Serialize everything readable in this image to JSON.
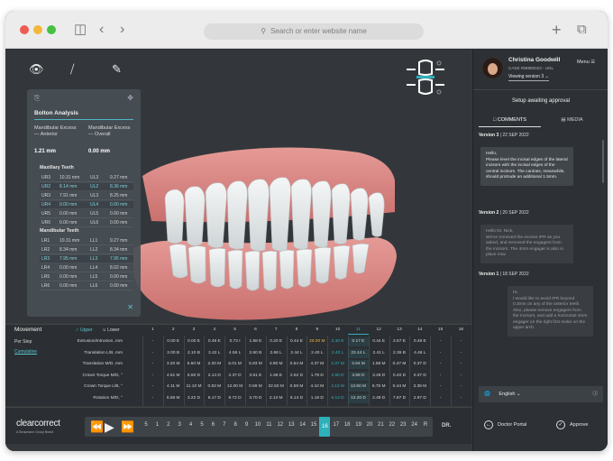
{
  "browser": {
    "url_placeholder": "Search or enter website name"
  },
  "user": {
    "name": "Christina Goodwill",
    "case": "CASE #59850023 - UNL",
    "version_select": "Viewing version 3",
    "menu_label": "Menu"
  },
  "panel": {
    "status": "Setup awaiting approval",
    "tabs": [
      "COMMENTS",
      "MEDIA"
    ],
    "comments": [
      {
        "version": "Version 3",
        "date": "22 SEP 2022",
        "text": "Hello,\nPlease level the incisal edges of the lateral incisors with the incisal edges of the central incisors. The canines, meanwhile, should protrude an additional 1.5mm.",
        "muted": false,
        "align": "left"
      },
      {
        "version": "Version 2",
        "date": "20 SEP 2022",
        "text": "Hello Dr. Nick,\nWe've removed the excess IPR as you asked, and removed the engagers from the incisors. The 4mm engager is also in place now.",
        "muted": true,
        "align": "left"
      },
      {
        "version": "Version 1",
        "date": "18 SEP 2022",
        "text": "Hi,\nI would like to avoid IPR beyond 0.3mm on any of the anterior teeth. Also, please remove engagers from the incisors, and add a horizontal 4mm engager on the right first molar on the upper arch.",
        "muted": true,
        "align": "right"
      }
    ],
    "language": "English",
    "doctor_portal": "Doctor Portal",
    "approve": "Approve"
  },
  "bolton": {
    "title": "Bolton Analysis",
    "anterior_label": "Mandibular Excess— Anterior",
    "overall_label": "Mandibular Excess— Overall",
    "anterior_value": "1.21 mm",
    "overall_value": "0.00 mm",
    "maxillary_title": "Maxillary Teeth",
    "mandibular_title": "Mandibular Teeth",
    "maxillary_rows": [
      {
        "a": "UR3",
        "b": "10.31 mm",
        "c": "UL3",
        "d": "9.27 mm",
        "hl": false
      },
      {
        "a": "UR2",
        "b": "8.14 mm",
        "c": "UL2",
        "d": "8.36 mm",
        "hl": true
      },
      {
        "a": "UR3",
        "b": "7.91 mm",
        "c": "UL3",
        "d": "8.25 mm",
        "hl": false
      },
      {
        "a": "UR4",
        "b": "0.00 mm",
        "c": "UL4",
        "d": "0.00 mm",
        "hl": true
      },
      {
        "a": "UR5",
        "b": "0.00 mm",
        "c": "UL5",
        "d": "0.00 mm",
        "hl": false
      },
      {
        "a": "UR6",
        "b": "0.00 mm",
        "c": "UL6",
        "d": "0.00 mm",
        "hl": false
      }
    ],
    "mandibular_rows": [
      {
        "a": "LR1",
        "b": "10.31 mm",
        "c": "LL1",
        "d": "9.27 mm",
        "hl": false
      },
      {
        "a": "LR2",
        "b": "8.34 mm",
        "c": "LL2",
        "d": "8.34 mm",
        "hl": false
      },
      {
        "a": "LR3",
        "b": "7.95 mm",
        "c": "LL3",
        "d": "7.95 mm",
        "hl": true
      },
      {
        "a": "LR4",
        "b": "0.00 mm",
        "c": "LL4",
        "d": "8.02 mm",
        "hl": false
      },
      {
        "a": "LR5",
        "b": "0.00 mm",
        "c": "LL5",
        "d": "0.00 mm",
        "hl": false
      },
      {
        "a": "LR6",
        "b": "0.00 mm",
        "c": "LL6",
        "d": "0.00 mm",
        "hl": false
      }
    ]
  },
  "movement": {
    "title": "Movement",
    "upper": "Upper",
    "lower": "Lower",
    "per_step": "Per Step",
    "cumulative": "Cumulative",
    "columns": [
      "1",
      "2",
      "3",
      "4",
      "5",
      "6",
      "7",
      "8",
      "9",
      "10",
      "11",
      "12",
      "13",
      "14",
      "15",
      "16"
    ],
    "highlight_col": 10,
    "rows": [
      {
        "label": "Extrusion/Intrusion, mm",
        "cells": [
          "-",
          "0.00 E",
          "0.00 E",
          "0.49 E",
          "0.73 I",
          "1.58 E",
          "0.20 E",
          "0.44 E",
          "20.00 M",
          "2.40 E",
          "0.17 E",
          "0.44 E",
          "2.67 E",
          "0.49 E",
          "-",
          "-"
        ]
      },
      {
        "label": "Translation L/B, mm",
        "cells": [
          "-",
          "2.00 B",
          "2.10 B",
          "2.42 L",
          "4.56 L",
          "2.60 B",
          "2.66 L",
          "2.44 L",
          "2.40 L",
          "2.40 L",
          "22.44 L",
          "2.41 L",
          "2.36 B",
          "4.46 L",
          "-",
          "-"
        ]
      },
      {
        "label": "Translation M/D, mm",
        "cells": [
          "-",
          "3.20 M",
          "6.50 M",
          "2.20 M",
          "6.01 M",
          "5.83 M",
          "3.90 M",
          "0.54 M",
          "4.37 M",
          "4.37 M",
          "3.94 M",
          "1.58 M",
          "0.47 M",
          "0.37 D",
          "-",
          "-"
        ]
      },
      {
        "label": "Crown Torque M/D, °",
        "cells": [
          "-",
          "4.51 M",
          "6.50 D",
          "2.14 D",
          "2.37 D",
          "3.51 E",
          "1.56 E",
          "2.52 D",
          "1.79 D",
          "2.50 D",
          "3.58 D",
          "3.26 D",
          "0.40 D",
          "0.37 D",
          "-",
          "-"
        ]
      },
      {
        "label": "Crown Torque L/B, °",
        "cells": [
          "-",
          "4.11 M",
          "11.10 M",
          "0.83 M",
          "12.00 M",
          "0.59 M",
          "22.50 M",
          "0.59 M",
          "4.10 M",
          "4.10 M",
          "13.50 M",
          "6.75 M",
          "0.44 M",
          "3.39 M",
          "-",
          "-"
        ]
      },
      {
        "label": "Rotation M/D, °",
        "cells": [
          "-",
          "6.59 M",
          "3.22 D",
          "6.17 D",
          "9.72 D",
          "3.70 D",
          "2.13 M",
          "6.14 D",
          "1.18 D",
          "6.14 D",
          "13.20 D",
          "2.49 D",
          "7.87 D",
          "2.97 D",
          "-",
          "-"
        ]
      }
    ]
  },
  "timeline": {
    "brand": "clearcorrect",
    "brand_sub": "A Straumann Group Brand",
    "stages": [
      "5",
      "1",
      "2",
      "3",
      "4",
      "5",
      "6",
      "7",
      "8",
      "9",
      "10",
      "11",
      "12",
      "13",
      "14",
      "15",
      "16",
      "17",
      "18",
      "19",
      "20",
      "21",
      "22",
      "23",
      "24",
      "R"
    ],
    "current_stage": "16",
    "dr_label": "DR."
  },
  "colors": {
    "accent": "#2fb0bb",
    "highlight_value": "#f2b73c"
  }
}
